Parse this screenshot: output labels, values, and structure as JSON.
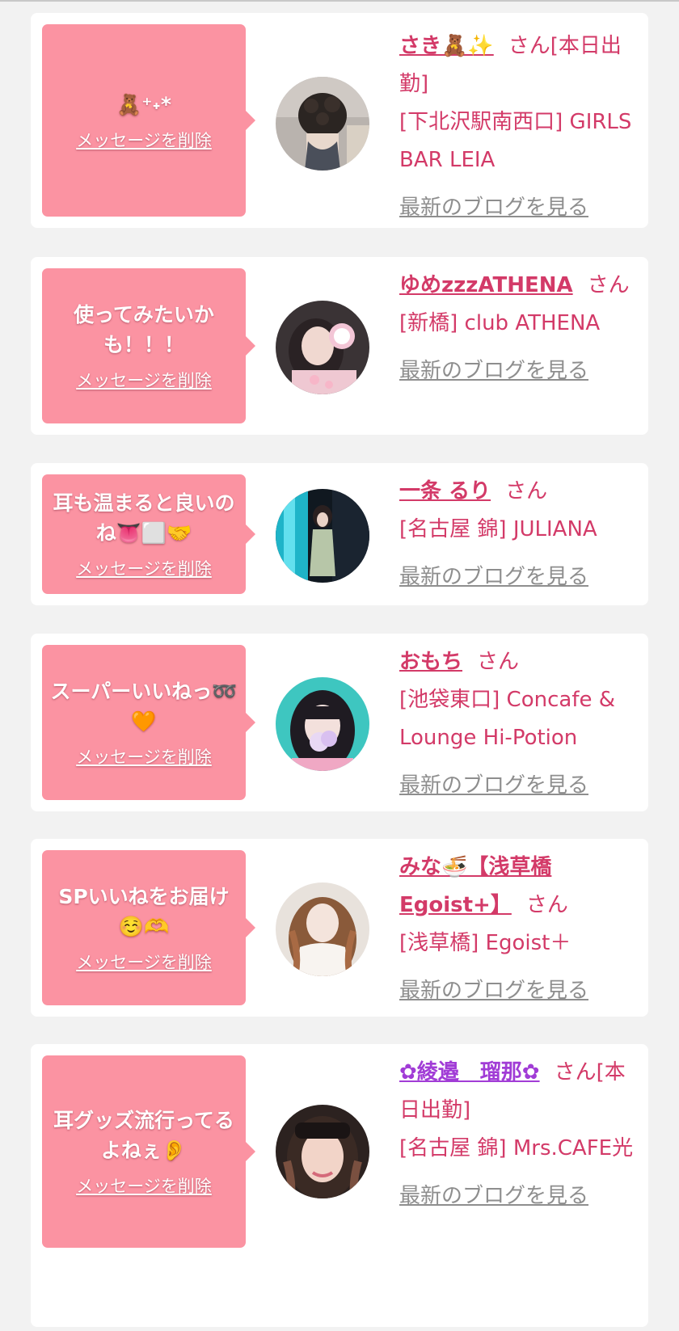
{
  "delete_label": "メッセージを削除",
  "blog_label": "最新のブログを見る",
  "san_label": "さん",
  "colors": {
    "page_bg": "#f2f2f2",
    "card_bg": "#ffffff",
    "bubble": "#fb93a2",
    "accent_text": "#d33a68",
    "link_gray": "#8e8e8e"
  },
  "items": [
    {
      "message": "🧸⁺˖*",
      "name": "さき🧸✨",
      "name_suffix": "[本日出勤]",
      "shop": "[下北沢駅南西口] GIRLS BAR LEIA"
    },
    {
      "message": "使ってみたいかも！！！",
      "name": "ゆめzzzATHENA",
      "name_suffix": "",
      "shop": "[新橋] club ATHENA"
    },
    {
      "message": "耳も温まると良いのね👅⬜🤝",
      "name": "一条 るり",
      "name_suffix": "",
      "shop": "[名古屋 錦] JULIANA"
    },
    {
      "message": "スーパーいいねっ➿🧡",
      "name": "おもち",
      "name_suffix": "",
      "shop": "[池袋東口] Concafe & Lounge Hi-Potion"
    },
    {
      "message": "SPいいねをお届け☺️🫶",
      "name": "みな🍜【浅草橋Egoist+】",
      "name_suffix": "",
      "shop": "[浅草橋] Egoist＋"
    },
    {
      "message": "耳グッズ流行ってるよねぇ👂",
      "name": "✿綾邉　瑠那✿",
      "name_suffix": "[本日出勤]",
      "shop": "[名古屋 錦] Mrs.CAFE光"
    }
  ]
}
